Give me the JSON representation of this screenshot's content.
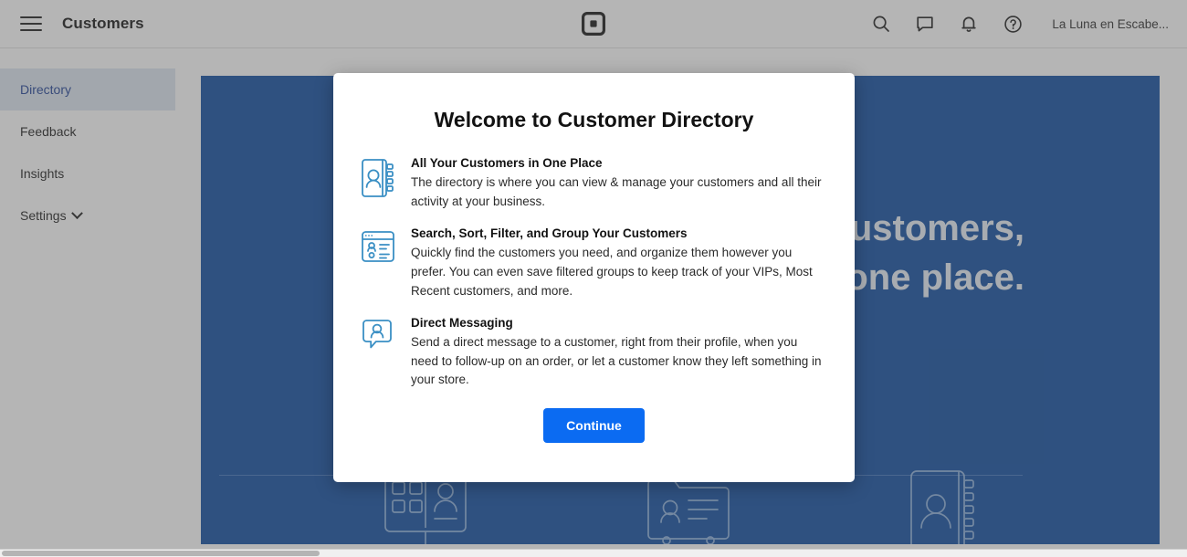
{
  "header": {
    "menu_icon": "hamburger-menu-icon",
    "title": "Customers",
    "logo": "square-logo",
    "actions": [
      {
        "icon": "search-icon",
        "label": "Search"
      },
      {
        "icon": "message-icon",
        "label": "Messages"
      },
      {
        "icon": "bell-icon",
        "label": "Notifications"
      },
      {
        "icon": "help-circle-icon",
        "label": "Help"
      }
    ],
    "account_name": "La Luna en Escabe..."
  },
  "sidebar": {
    "items": [
      {
        "label": "Directory",
        "active": true,
        "chevron": false
      },
      {
        "label": "Feedback",
        "active": false,
        "chevron": false
      },
      {
        "label": "Insights",
        "active": false,
        "chevron": false
      },
      {
        "label": "Settings",
        "active": false,
        "chevron": true
      }
    ]
  },
  "hero": {
    "line1": "All your customers,",
    "line2": "in one place.",
    "background_color": "#0b4a9e",
    "illustrations": [
      "desktop-customer-profile-icon",
      "folder-contact-card-icon",
      "address-book-icon"
    ]
  },
  "modal": {
    "title": "Welcome to Customer Directory",
    "features": [
      {
        "icon": "address-book-icon",
        "title": "All Your Customers in One Place",
        "desc": "The directory is where you can view & manage your customers and all their activity at your business."
      },
      {
        "icon": "customer-list-window-icon",
        "title": "Search, Sort, Filter, and Group Your Customers",
        "desc": "Quickly find the customers you need, and organize them however you prefer. You can even save filtered groups to keep track of your VIPs, Most Recent customers, and more."
      },
      {
        "icon": "message-person-icon",
        "title": "Direct Messaging",
        "desc": "Send a direct message to a customer, right from their profile, when you need to follow-up on an order, or let a customer know they left something in your store."
      }
    ],
    "continue_label": "Continue",
    "accent_color": "#0b6bf2"
  }
}
